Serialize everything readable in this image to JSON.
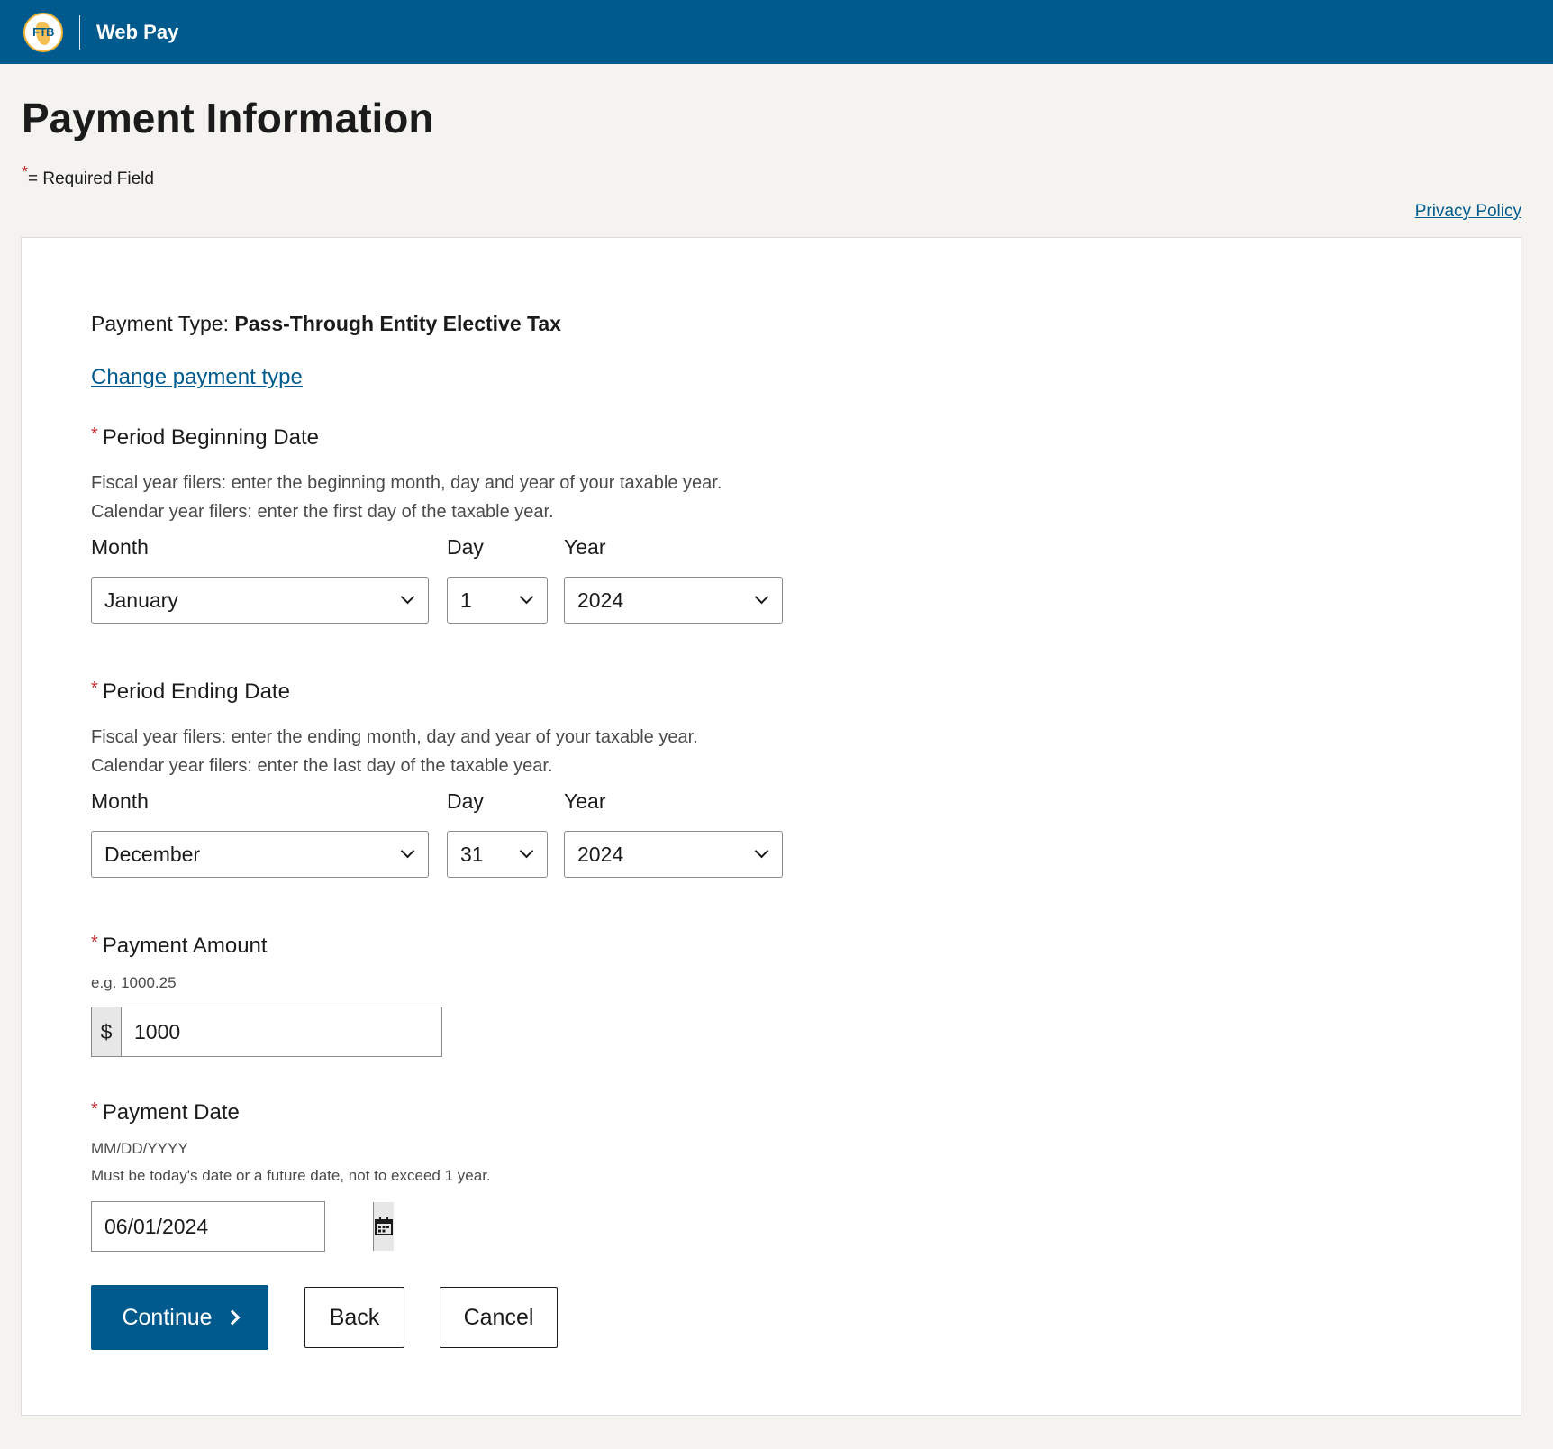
{
  "header": {
    "logo_text": "FTB",
    "app_title": "Web Pay"
  },
  "page": {
    "title": "Payment Information",
    "required_star": "*",
    "required_note": "= Required Field",
    "privacy_link": "Privacy Policy"
  },
  "payment_type": {
    "label": "Payment Type:",
    "value": "Pass-Through Entity Elective Tax",
    "change_link": "Change payment type"
  },
  "period_begin": {
    "star": "*",
    "label": "Period Beginning Date",
    "help_line1": "Fiscal year filers: enter the beginning month, day and year of your taxable year.",
    "help_line2": "Calendar year filers: enter the first day of the taxable year.",
    "month_label": "Month",
    "day_label": "Day",
    "year_label": "Year",
    "month": "January",
    "day": "1",
    "year": "2024"
  },
  "period_end": {
    "star": "*",
    "label": "Period Ending Date",
    "help_line1": "Fiscal year filers: enter the ending month, day and year of your taxable year.",
    "help_line2": "Calendar year filers: enter the last day of the taxable year.",
    "month_label": "Month",
    "day_label": "Day",
    "year_label": "Year",
    "month": "December",
    "day": "31",
    "year": "2024"
  },
  "payment_amount": {
    "star": "*",
    "label": "Payment Amount",
    "hint": "e.g. 1000.25",
    "prefix": "$",
    "value": "1000"
  },
  "payment_date": {
    "star": "*",
    "label": "Payment Date",
    "format_hint": "MM/DD/YYYY",
    "rule_hint": "Must be today's date or a future date, not to exceed 1 year.",
    "value": "06/01/2024",
    "calendar_icon": "calendar-icon"
  },
  "actions": {
    "continue_label": "Continue",
    "back_label": "Back",
    "cancel_label": "Cancel"
  },
  "colors": {
    "brand_blue": "#005a8e",
    "required_red": "#c0272d",
    "page_bg": "#f4f3f0",
    "logo_gold": "#f2b538"
  }
}
